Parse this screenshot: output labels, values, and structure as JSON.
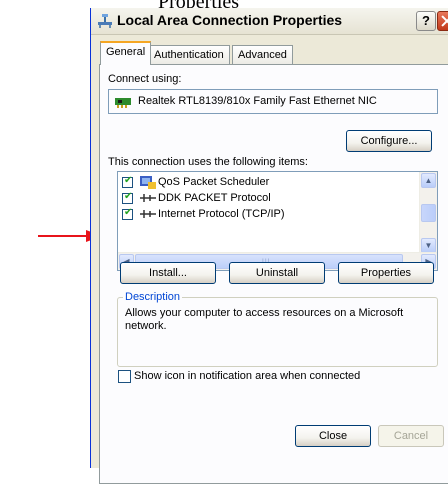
{
  "top_text": "Properties",
  "window": {
    "title": "Local Area Connection Properties",
    "help_label": "?"
  },
  "tabs": [
    {
      "label": "General",
      "active": true
    },
    {
      "label": "Authentication",
      "active": false
    },
    {
      "label": "Advanced",
      "active": false
    }
  ],
  "connect_using": {
    "label": "Connect using:",
    "adapter": "Realtek RTL8139/810x Family Fast Ethernet NIC",
    "configure_button": "Configure..."
  },
  "items_section": {
    "label": "This connection uses the following items:",
    "items": [
      {
        "label": "QoS Packet Scheduler",
        "checked": true,
        "icon": "qos-icon"
      },
      {
        "label": "DDK PACKET Protocol",
        "checked": true,
        "icon": "protocol-icon"
      },
      {
        "label": "Internet Protocol (TCP/IP)",
        "checked": true,
        "icon": "protocol-icon"
      }
    ]
  },
  "buttons": {
    "install": "Install...",
    "uninstall": "Uninstall",
    "properties": "Properties",
    "close": "Close",
    "cancel": "Cancel"
  },
  "description": {
    "title": "Description",
    "text": "Allows your computer to access resources on a Microsoft network."
  },
  "show_icon_checkbox": {
    "label": "Show icon in notification area when connected",
    "checked": false
  },
  "colors": {
    "arrow": "#e8141b",
    "title_bar": "#ece9d8",
    "close_button": "#c1391a",
    "group_label": "#0046d5"
  }
}
